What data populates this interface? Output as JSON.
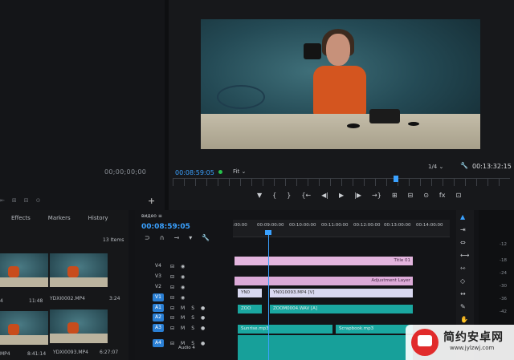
{
  "source_monitor": {
    "timecode": "00;00;00;00",
    "add_label": "+"
  },
  "program_monitor": {
    "timecode": "00:08:59:05",
    "fit": "Fit",
    "quality": "1/4",
    "duration": "00:13:32:15",
    "transport": [
      "▼",
      "{",
      "}",
      "{←",
      "◀|",
      "▶",
      "|▶",
      "→}",
      "⊞",
      "⊟",
      "⊙",
      "fx",
      "⊡"
    ]
  },
  "project_panel": {
    "tabs": [
      "Effects",
      "Markers",
      "History"
    ],
    "items_count": "13 Items",
    "thumbs": [
      {
        "name": "4",
        "duration": "11:48"
      },
      {
        "name": "YDXI0002.MP4",
        "duration": "3:24"
      },
      {
        "name": "MP4",
        "duration": "8:41:14"
      },
      {
        "name": "YDXI0093.MP4",
        "duration": "6:27:07"
      }
    ]
  },
  "sequence": {
    "title": "видео ≡",
    "timecode": "00:08:59:05",
    "ruler_ticks": [
      ":00:00",
      "00:09:00:00",
      "00:10:00:00",
      "00:11:00:00",
      "00:12:00:00",
      "00:13:00:00",
      "00:14:00:00"
    ],
    "tracks": [
      "V4",
      "V3",
      "V2",
      "V1",
      "A1",
      "A2",
      "A3",
      "A4"
    ],
    "audio4_label": "Audio 4",
    "clips": {
      "title": "Title 01",
      "adjustment": "Adjustment Layer",
      "v1_a": "YN0",
      "v1_b": "YN010093.MP4 [V]",
      "a1": "ZOOM0004.WAV [A]",
      "a1_short": "ZOO",
      "a3_a": "Sunrise.mp3",
      "a3_b": "Scrapbook.mp3"
    }
  },
  "meter": {
    "levels": [
      "-12",
      "-18",
      "-24",
      "-30",
      "-36",
      "-42"
    ]
  },
  "watermark": {
    "title": "简约安卓网",
    "url": "www.jylzwj.com"
  }
}
